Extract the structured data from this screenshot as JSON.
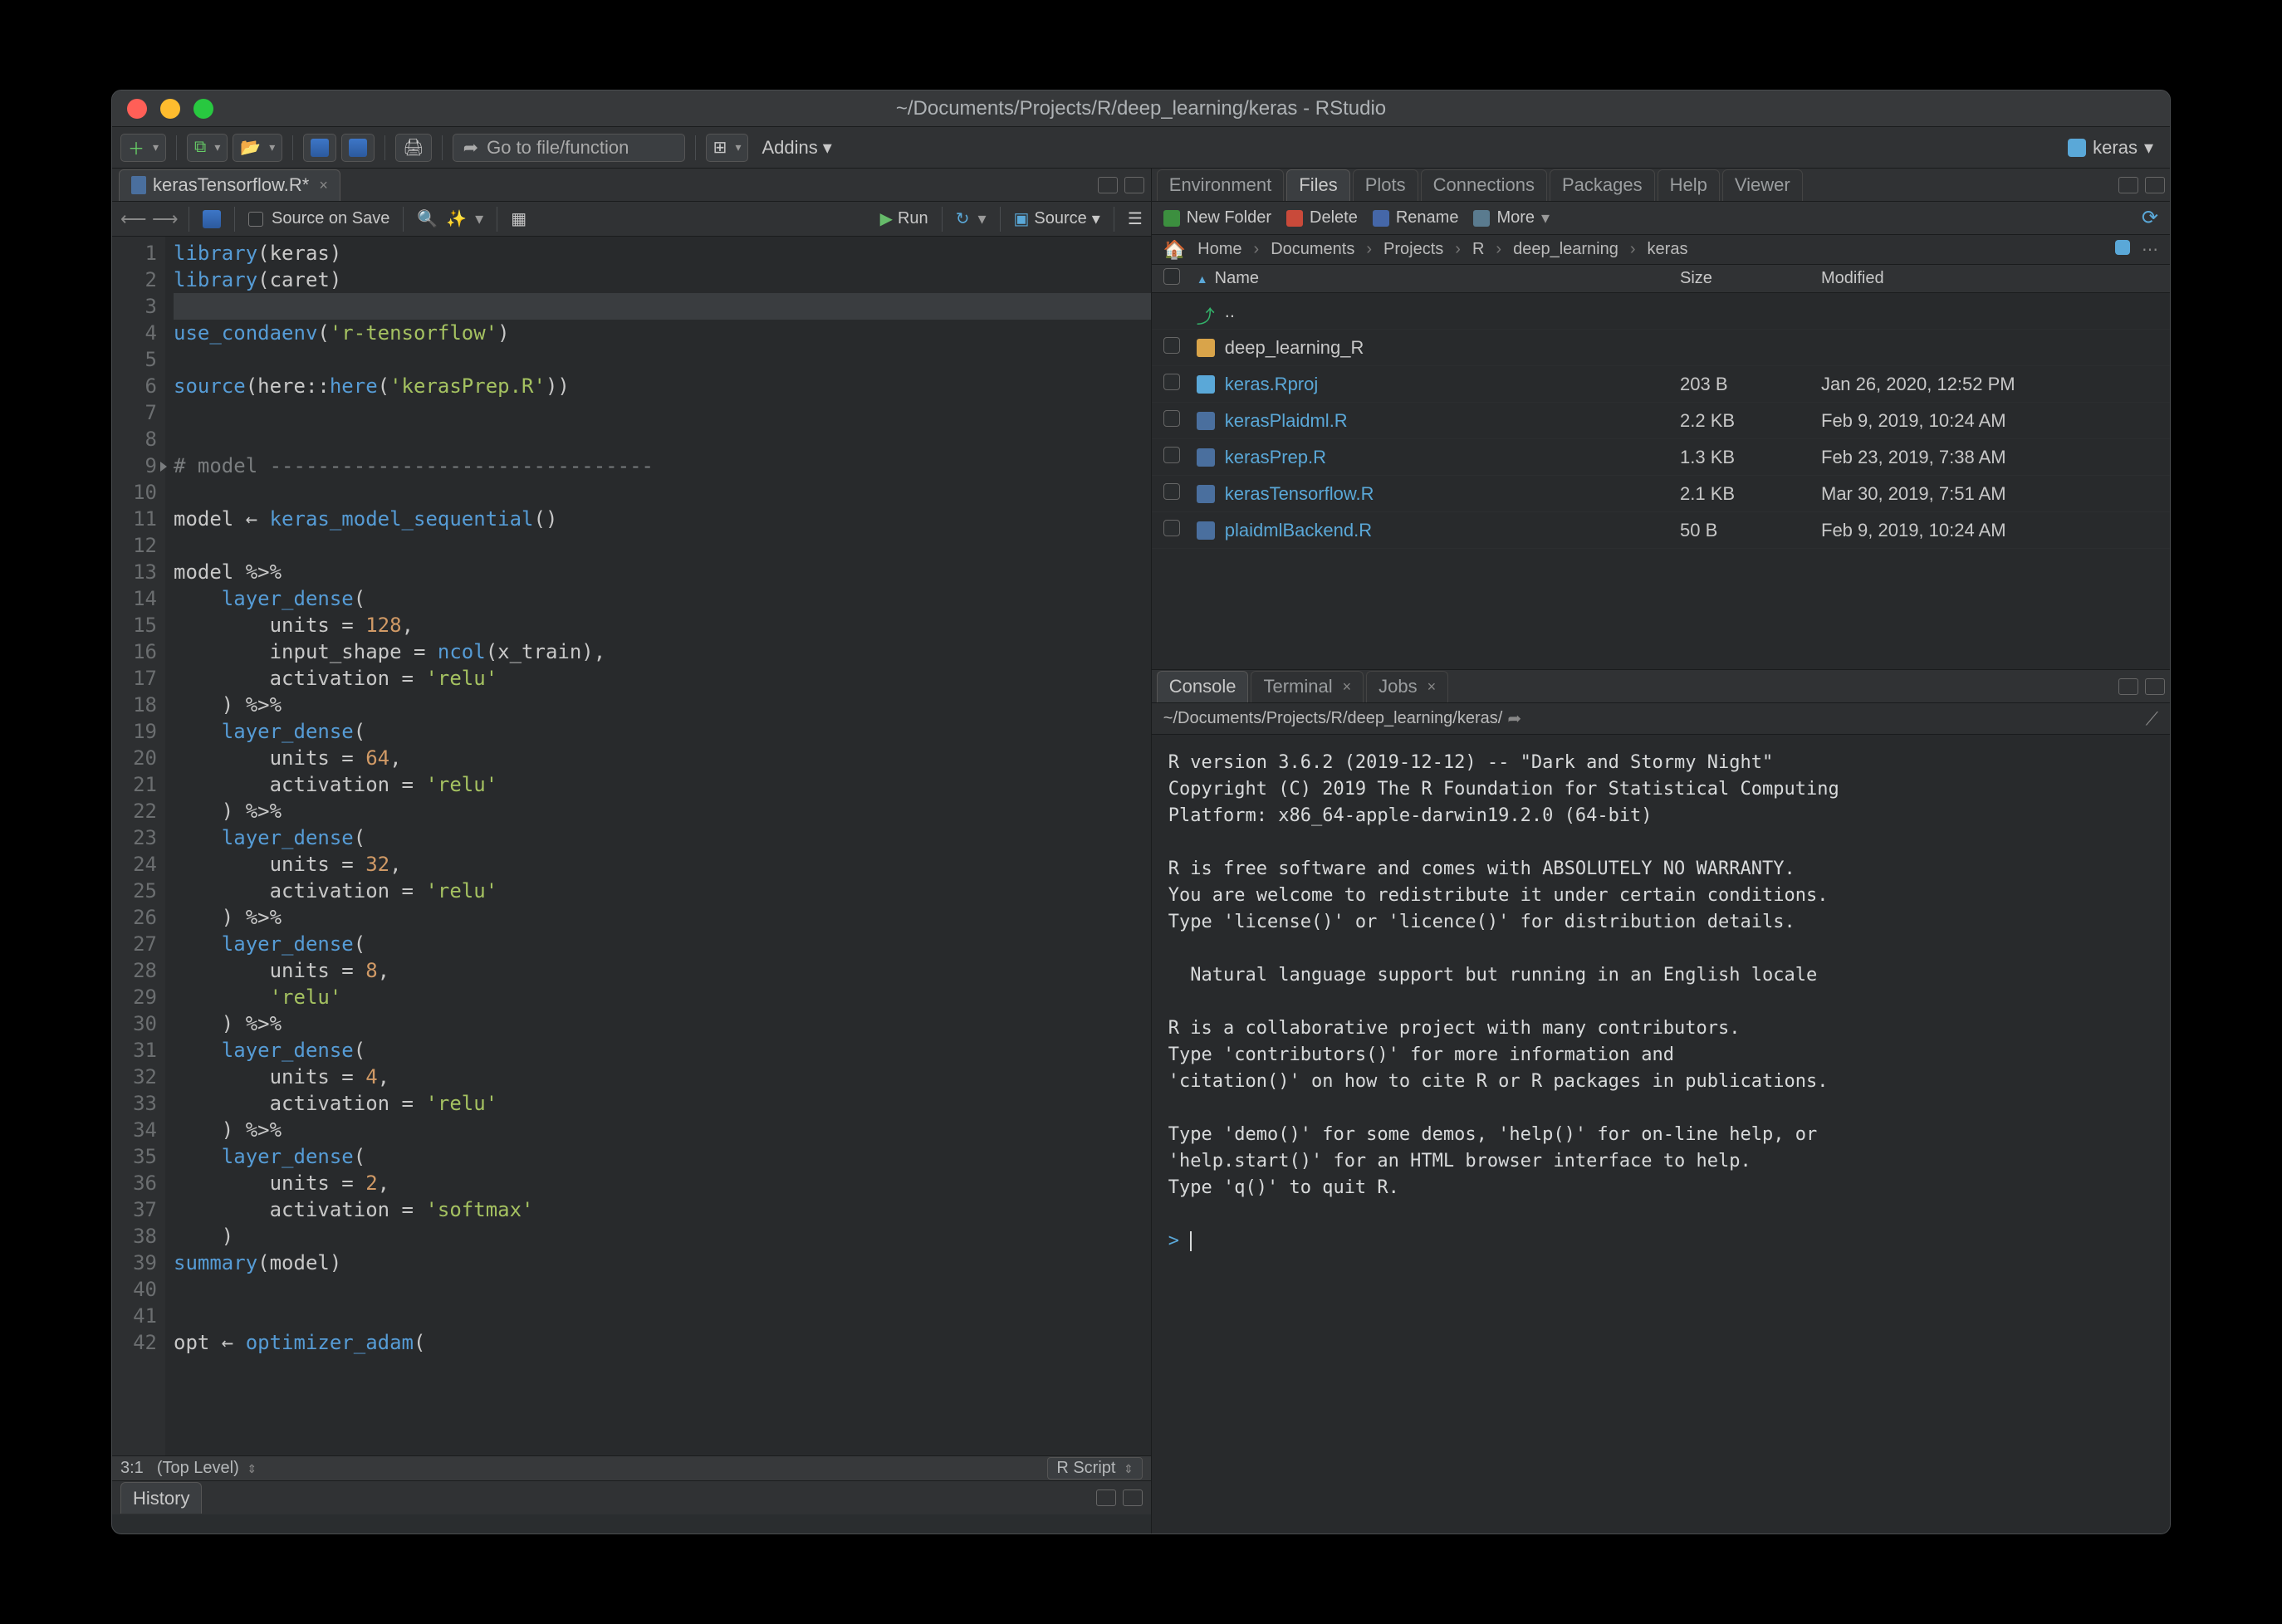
{
  "window": {
    "title": "~/Documents/Projects/R/deep_learning/keras - RStudio"
  },
  "toolbar": {
    "goto_placeholder": "Go to file/function",
    "addins_label": "Addins",
    "project_label": "keras"
  },
  "source": {
    "tab_name": "kerasTensorflow.R*",
    "source_on_save": "Source on Save",
    "run_label": "Run",
    "source_label": "Source",
    "status_pos": "3:1",
    "status_scope": "(Top Level)",
    "status_lang": "R Script"
  },
  "code_lines": [
    {
      "n": 1,
      "html": "<span class='tok-fn'>library</span><span class='tok-par'>(</span>keras<span class='tok-par'>)</span>"
    },
    {
      "n": 2,
      "html": "<span class='tok-fn'>library</span><span class='tok-par'>(</span>caret<span class='tok-par'>)</span>"
    },
    {
      "n": 3,
      "html": "",
      "highlight": true
    },
    {
      "n": 4,
      "html": "<span class='tok-fn'>use_condaenv</span><span class='tok-par'>(</span><span class='tok-str'>'r-tensorflow'</span><span class='tok-par'>)</span>"
    },
    {
      "n": 5,
      "html": ""
    },
    {
      "n": 6,
      "html": "<span class='tok-fn'>source</span><span class='tok-par'>(</span>here<span class='tok-ns'>::</span><span class='tok-fn'>here</span><span class='tok-par'>(</span><span class='tok-str'>'kerasPrep.R'</span><span class='tok-par'>))</span>"
    },
    {
      "n": 7,
      "html": ""
    },
    {
      "n": 8,
      "html": ""
    },
    {
      "n": 9,
      "html": "<span class='tok-cmt'># model --------------------------------</span>",
      "fold": true
    },
    {
      "n": 10,
      "html": ""
    },
    {
      "n": 11,
      "html": "model <span class='tok-ass'>&larr;</span> <span class='tok-fn'>keras_model_sequential</span><span class='tok-par'>()</span>"
    },
    {
      "n": 12,
      "html": ""
    },
    {
      "n": 13,
      "html": "model <span class='tok-op'>%&gt;%</span>"
    },
    {
      "n": 14,
      "html": "    <span class='tok-fn'>layer_dense</span><span class='tok-par'>(</span>"
    },
    {
      "n": 15,
      "html": "        units <span class='tok-op'>=</span> <span class='tok-num'>128</span>,"
    },
    {
      "n": 16,
      "html": "        input_shape <span class='tok-op'>=</span> <span class='tok-fn'>ncol</span><span class='tok-par'>(</span>x_train<span class='tok-par'>)</span>,"
    },
    {
      "n": 17,
      "html": "        activation <span class='tok-op'>=</span> <span class='tok-str'>'relu'</span>"
    },
    {
      "n": 18,
      "html": "    <span class='tok-par'>)</span> <span class='tok-op'>%&gt;%</span>"
    },
    {
      "n": 19,
      "html": "    <span class='tok-fn'>layer_dense</span><span class='tok-par'>(</span>"
    },
    {
      "n": 20,
      "html": "        units <span class='tok-op'>=</span> <span class='tok-num'>64</span>,"
    },
    {
      "n": 21,
      "html": "        activation <span class='tok-op'>=</span> <span class='tok-str'>'relu'</span>"
    },
    {
      "n": 22,
      "html": "    <span class='tok-par'>)</span> <span class='tok-op'>%&gt;%</span>"
    },
    {
      "n": 23,
      "html": "    <span class='tok-fn'>layer_dense</span><span class='tok-par'>(</span>"
    },
    {
      "n": 24,
      "html": "        units <span class='tok-op'>=</span> <span class='tok-num'>32</span>,"
    },
    {
      "n": 25,
      "html": "        activation <span class='tok-op'>=</span> <span class='tok-str'>'relu'</span>"
    },
    {
      "n": 26,
      "html": "    <span class='tok-par'>)</span> <span class='tok-op'>%&gt;%</span>"
    },
    {
      "n": 27,
      "html": "    <span class='tok-fn'>layer_dense</span><span class='tok-par'>(</span>"
    },
    {
      "n": 28,
      "html": "        units <span class='tok-op'>=</span> <span class='tok-num'>8</span>,"
    },
    {
      "n": 29,
      "html": "        <span class='tok-str'>'relu'</span>"
    },
    {
      "n": 30,
      "html": "    <span class='tok-par'>)</span> <span class='tok-op'>%&gt;%</span>"
    },
    {
      "n": 31,
      "html": "    <span class='tok-fn'>layer_dense</span><span class='tok-par'>(</span>"
    },
    {
      "n": 32,
      "html": "        units <span class='tok-op'>=</span> <span class='tok-num'>4</span>,"
    },
    {
      "n": 33,
      "html": "        activation <span class='tok-op'>=</span> <span class='tok-str'>'relu'</span>"
    },
    {
      "n": 34,
      "html": "    <span class='tok-par'>)</span> <span class='tok-op'>%&gt;%</span>"
    },
    {
      "n": 35,
      "html": "    <span class='tok-fn'>layer_dense</span><span class='tok-par'>(</span>"
    },
    {
      "n": 36,
      "html": "        units <span class='tok-op'>=</span> <span class='tok-num'>2</span>,"
    },
    {
      "n": 37,
      "html": "        activation <span class='tok-op'>=</span> <span class='tok-str'>'softmax'</span>"
    },
    {
      "n": 38,
      "html": "    <span class='tok-par'>)</span>"
    },
    {
      "n": 39,
      "html": "<span class='tok-fn'>summary</span><span class='tok-par'>(</span>model<span class='tok-par'>)</span>"
    },
    {
      "n": 40,
      "html": ""
    },
    {
      "n": 41,
      "html": ""
    },
    {
      "n": 42,
      "html": "opt <span class='tok-ass'>&larr;</span> <span class='tok-fn'>optimizer_adam</span><span class='tok-par'>(</span>"
    }
  ],
  "history": {
    "tab": "History"
  },
  "files": {
    "tabs": [
      "Environment",
      "Files",
      "Plots",
      "Connections",
      "Packages",
      "Help",
      "Viewer"
    ],
    "active_tab": 1,
    "tb": {
      "new": "New Folder",
      "del": "Delete",
      "ren": "Rename",
      "more": "More"
    },
    "breadcrumbs": [
      "Home",
      "Documents",
      "Projects",
      "R",
      "deep_learning",
      "keras"
    ],
    "cols": {
      "name": "Name",
      "size": "Size",
      "mod": "Modified"
    },
    "rows": [
      {
        "up": true,
        "name": ".."
      },
      {
        "icon": "folder",
        "name": "deep_learning_R",
        "size": "",
        "mod": ""
      },
      {
        "icon": "rproj",
        "name": "keras.Rproj",
        "size": "203 B",
        "mod": "Jan 26, 2020, 12:52 PM",
        "link": true
      },
      {
        "icon": "rfile",
        "name": "kerasPlaidml.R",
        "size": "2.2 KB",
        "mod": "Feb 9, 2019, 10:24 AM",
        "link": true
      },
      {
        "icon": "rfile",
        "name": "kerasPrep.R",
        "size": "1.3 KB",
        "mod": "Feb 23, 2019, 7:38 AM",
        "link": true
      },
      {
        "icon": "rfile",
        "name": "kerasTensorflow.R",
        "size": "2.1 KB",
        "mod": "Mar 30, 2019, 7:51 AM",
        "link": true
      },
      {
        "icon": "rfile",
        "name": "plaidmlBackend.R",
        "size": "50 B",
        "mod": "Feb 9, 2019, 10:24 AM",
        "link": true
      }
    ]
  },
  "console": {
    "tabs": [
      "Console",
      "Terminal",
      "Jobs"
    ],
    "active_tab": 0,
    "path": "~/Documents/Projects/R/deep_learning/keras/",
    "body": "R version 3.6.2 (2019-12-12) -- \"Dark and Stormy Night\"\nCopyright (C) 2019 The R Foundation for Statistical Computing\nPlatform: x86_64-apple-darwin19.2.0 (64-bit)\n\nR is free software and comes with ABSOLUTELY NO WARRANTY.\nYou are welcome to redistribute it under certain conditions.\nType 'license()' or 'licence()' for distribution details.\n\n  Natural language support but running in an English locale\n\nR is a collaborative project with many contributors.\nType 'contributors()' for more information and\n'citation()' on how to cite R or R packages in publications.\n\nType 'demo()' for some demos, 'help()' for on-line help, or\n'help.start()' for an HTML browser interface to help.\nType 'q()' to quit R.\n"
  }
}
